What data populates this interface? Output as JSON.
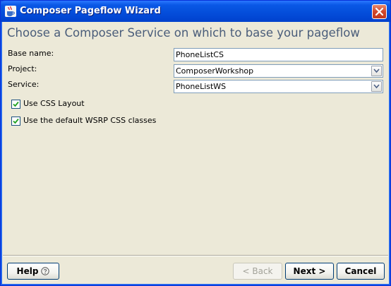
{
  "window": {
    "title": "Composer Pageflow Wizard",
    "app_icon": "java-coffee-icon",
    "close_icon": "close-icon"
  },
  "heading": "Choose a Composer Service on which to base your pageflow",
  "form": {
    "base_name_label": "Base name:",
    "base_name_value": "PhoneListCS",
    "project_label": "Project:",
    "project_value": "ComposerWorkshop",
    "service_label": "Service:",
    "service_value": "PhoneListWS",
    "use_css_layout_label": "Use CSS Layout",
    "use_css_layout_checked": true,
    "use_wsrp_css_label": "Use the default WSRP CSS classes",
    "use_wsrp_css_checked": true
  },
  "buttons": {
    "help": "Help",
    "help_icon": "question-circle-icon",
    "back": "< Back",
    "next": "Next >",
    "cancel": "Cancel"
  },
  "colors": {
    "title_bar": "#0550dc",
    "heading_text": "#4a5d7a",
    "dialog_bg": "#ece9d8",
    "close_button": "#d2472a"
  }
}
